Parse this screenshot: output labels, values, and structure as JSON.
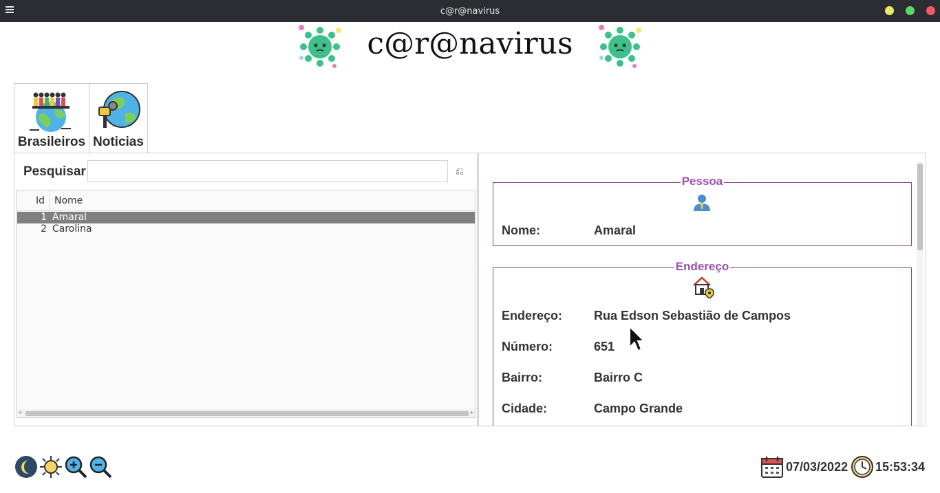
{
  "window": {
    "title": "c@r@navirus",
    "controls": {
      "minimize_color": "#e9e96a",
      "maximize_color": "#5dd95d",
      "close_color": "#f25a6a"
    }
  },
  "banner": {
    "title": "c@r@navirus",
    "icon": "virus-icon"
  },
  "tabs": [
    {
      "label": "Brasileiros",
      "icon": "people-globe-icon"
    },
    {
      "label": "Noticias",
      "icon": "news-globe-icon"
    }
  ],
  "search": {
    "label": "Pesquisar",
    "value": "",
    "placeholder": ""
  },
  "table": {
    "columns": [
      "Id",
      "Nome"
    ],
    "rows": [
      {
        "id": "1",
        "nome": "Amaral",
        "selected": true
      },
      {
        "id": "2",
        "nome": "Carolina",
        "selected": false
      }
    ]
  },
  "pessoa": {
    "title": "Pessoa",
    "icon": "person-icon",
    "nome_label": "Nome:",
    "nome_value": "Amaral"
  },
  "endereco": {
    "title": "Endereço",
    "icon": "house-location-icon",
    "fields": [
      {
        "label": "Endereço:",
        "value": "Rua Edson Sebastião de Campos"
      },
      {
        "label": "Número:",
        "value": "651"
      },
      {
        "label": "Bairro:",
        "value": "Bairro C"
      },
      {
        "label": "Cidade:",
        "value": "Campo Grande"
      }
    ]
  },
  "footer": {
    "date": "07/03/2022",
    "time": "15:53:34",
    "tools": [
      "moon-icon",
      "sun-icon",
      "zoom-in-icon",
      "zoom-out-icon"
    ]
  },
  "colors": {
    "accent": "#9b4fb0",
    "selection": "#808080",
    "titlebar": "#2b2d33"
  }
}
